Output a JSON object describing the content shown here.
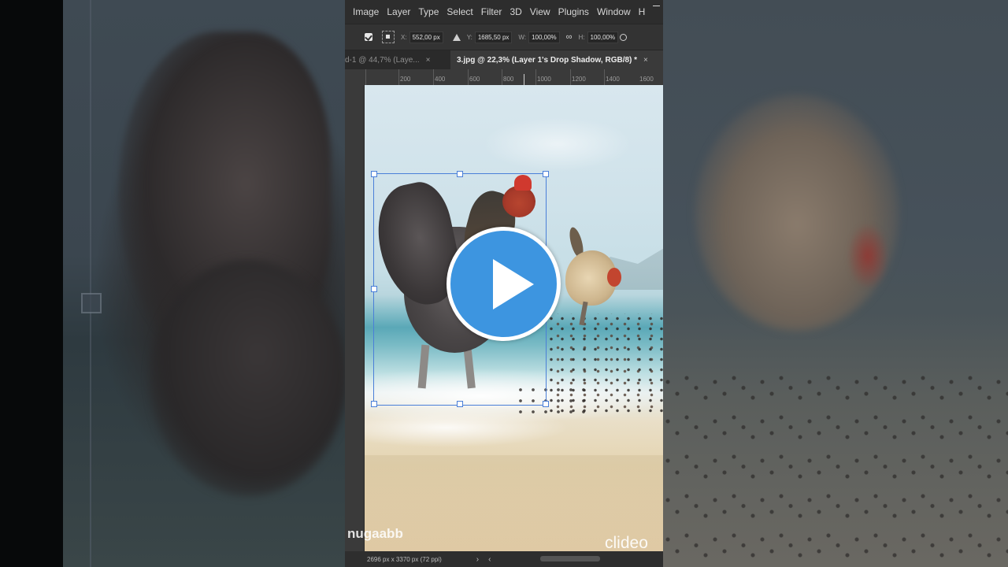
{
  "menu": {
    "items": [
      "Image",
      "Layer",
      "Type",
      "Select",
      "Filter",
      "3D",
      "View",
      "Plugins",
      "Window",
      "H"
    ]
  },
  "options": {
    "x_label": "X:",
    "x_value": "552,00 px",
    "y_label": "Y:",
    "y_value": "1685,50 px",
    "w_label": "W:",
    "w_value": "100,00%",
    "h_label": "H:",
    "h_value": "100,00%"
  },
  "tabs": [
    {
      "label": "d-1 @ 44,7% (Laye...",
      "active": false
    },
    {
      "label": "3.jpg @ 22,3% (Layer 1's Drop Shadow, RGB/8) *",
      "active": true
    }
  ],
  "ruler": {
    "ticks": [
      "200",
      "400",
      "600",
      "800",
      "1000",
      "1200",
      "1400",
      "1600"
    ]
  },
  "status": {
    "info": "2696 px x 3370 px (72 ppi)"
  },
  "watermarks": {
    "creator": "nugaabb",
    "brand": "clideo"
  },
  "icons": {
    "play": "play-icon",
    "close": "close-icon",
    "link": "link-icon",
    "angle": "angle-icon",
    "search": "search-icon"
  },
  "colors": {
    "play_button": "#3d95e0",
    "selection": "#4a7fd8"
  }
}
